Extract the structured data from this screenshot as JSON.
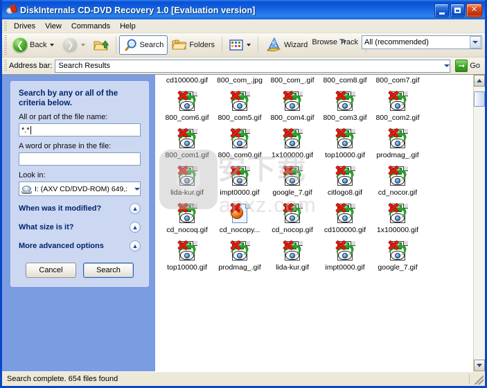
{
  "window": {
    "title": "DiskInternals CD-DVD Recovery 1.0 [Evaluation version]",
    "app_icon": "cd-disc-icon",
    "minimize_label": "Minimize",
    "maximize_label": "Maximize",
    "close_label": "Close"
  },
  "menubar": {
    "items": [
      {
        "label": "Drives"
      },
      {
        "label": "View"
      },
      {
        "label": "Commands"
      },
      {
        "label": "Help"
      }
    ]
  },
  "toolbar": {
    "back_label": "Back",
    "back_icon": "back-arrow-icon",
    "forward_icon": "forward-arrow-icon",
    "up_icon": "up-folder-icon",
    "search_label": "Search",
    "search_icon": "magnifier-icon",
    "folders_label": "Folders",
    "folders_icon": "folder-icon",
    "views_icon": "views-grid-icon",
    "wizard_label": "Wizard",
    "wizard_icon": "wizard-hat-icon",
    "overflow_label": "»",
    "browse_track_label": "Browse Track",
    "browse_track_value": "All (recommended)"
  },
  "address": {
    "label": "Address bar:",
    "value": "Search Results",
    "go_label": "Go",
    "go_icon": "green-arrow-icon"
  },
  "search_panel": {
    "title": "Search by any or all of the criteria below.",
    "filename_label": "All or part of the file name:",
    "filename_value": "*.*",
    "phrase_label": "A word or phrase in the file:",
    "phrase_value": "",
    "lookin_label": "Look in:",
    "lookin_value": "I: (AXV  CD/DVD-ROM) 649,:",
    "lookin_icon": "cd-drive-icon",
    "sections": [
      {
        "label": "When was it modified?",
        "toggle_icon": "chevron-up-double-icon"
      },
      {
        "label": "What size is it?",
        "toggle_icon": "chevron-up-double-icon"
      },
      {
        "label": "More advanced options",
        "toggle_icon": "chevron-up-double-icon"
      }
    ],
    "cancel_label": "Cancel",
    "search_label": "Search"
  },
  "files": {
    "items": [
      {
        "name": "cd100000.gif",
        "icon": "gif-recovery-icon",
        "first_row": true
      },
      {
        "name": "800_com_.jpg",
        "icon": "gif-recovery-icon",
        "first_row": true
      },
      {
        "name": "800_com_.gif",
        "icon": "gif-recovery-icon",
        "first_row": true
      },
      {
        "name": "800_com8.gif",
        "icon": "gif-recovery-icon",
        "first_row": true
      },
      {
        "name": "800_com7.gif",
        "icon": "gif-recovery-icon",
        "first_row": true
      },
      {
        "name": "800_com6.gif",
        "icon": "gif-recovery-icon",
        "first_row": false
      },
      {
        "name": "800_com5.gif",
        "icon": "gif-recovery-icon",
        "first_row": false
      },
      {
        "name": "800_com4.gif",
        "icon": "gif-recovery-icon",
        "first_row": false
      },
      {
        "name": "800_com3.gif",
        "icon": "gif-recovery-icon",
        "first_row": false
      },
      {
        "name": "800_com2.gif",
        "icon": "gif-recovery-icon",
        "first_row": false
      },
      {
        "name": "800_com1.gif",
        "icon": "gif-recovery-icon",
        "first_row": false
      },
      {
        "name": "800_com0.gif",
        "icon": "gif-recovery-icon",
        "first_row": false
      },
      {
        "name": "1x100000.gif",
        "icon": "gif-recovery-icon",
        "first_row": false
      },
      {
        "name": "top10000.gif",
        "icon": "gif-recovery-icon",
        "first_row": false
      },
      {
        "name": "prodmag_.gif",
        "icon": "gif-recovery-icon",
        "first_row": false
      },
      {
        "name": "lida-kur.gif",
        "icon": "gif-recovery-icon",
        "first_row": false
      },
      {
        "name": "impt0000.gif",
        "icon": "gif-recovery-icon",
        "first_row": false
      },
      {
        "name": "google_7.gif",
        "icon": "gif-recovery-icon",
        "first_row": false
      },
      {
        "name": "citlogo8.gif",
        "icon": "gif-recovery-icon",
        "first_row": false
      },
      {
        "name": "cd_nocor.gif",
        "icon": "gif-recovery-icon",
        "first_row": false
      },
      {
        "name": "cd_nocoq.gif",
        "icon": "gif-recovery-icon",
        "first_row": false
      },
      {
        "name": "cd_nocopy...",
        "icon": "firefox-html-icon",
        "first_row": false
      },
      {
        "name": "cd_nocop.gif",
        "icon": "gif-recovery-icon",
        "first_row": false
      },
      {
        "name": "cd100000.gif",
        "icon": "gif-recovery-icon",
        "first_row": false
      },
      {
        "name": "1x100000.gif",
        "icon": "gif-recovery-icon",
        "first_row": false
      },
      {
        "name": "top10000.gif",
        "icon": "gif-recovery-icon",
        "first_row": false
      },
      {
        "name": "prodmag_.gif",
        "icon": "gif-recovery-icon",
        "first_row": false
      },
      {
        "name": "lida-kur.gif",
        "icon": "gif-recovery-icon",
        "first_row": false
      },
      {
        "name": "impt0000.gif",
        "icon": "gif-recovery-icon",
        "first_row": false
      },
      {
        "name": "google_7.gif",
        "icon": "gif-recovery-icon",
        "first_row": false
      }
    ]
  },
  "watermark": {
    "characters": "安下载",
    "domain": "anxz.com"
  },
  "statusbar": {
    "text": "Search complete. 654 files found"
  },
  "colors": {
    "title_blue": "#0a4fd4",
    "sidebar_blue": "#7a9de2",
    "panel_lavender": "#ccd7f2",
    "toolbar_beige": "#ece9d8",
    "accent_green": "#2c8a14",
    "close_red": "#bd2c06"
  }
}
